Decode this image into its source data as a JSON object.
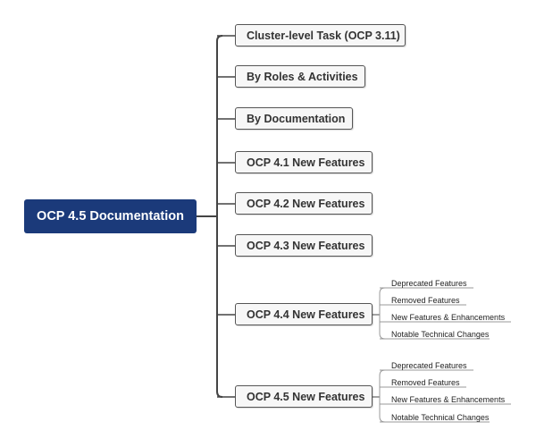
{
  "root": {
    "label": "OCP 4.5 Documentation",
    "color": "#1b3a7a"
  },
  "branches": [
    {
      "label": "Cluster-level Task (OCP 3.11)",
      "children": []
    },
    {
      "label": "By Roles & Activities",
      "children": []
    },
    {
      "label": "By Documentation",
      "children": []
    },
    {
      "label": "OCP 4.1 New Features",
      "children": []
    },
    {
      "label": "OCP 4.2 New Features",
      "children": []
    },
    {
      "label": "OCP 4.3 New Features",
      "children": []
    },
    {
      "label": "OCP 4.4 New Features",
      "children": [
        "Deprecated Features",
        "Removed Features",
        "New Features & Enhancements",
        "Notable Technical Changes"
      ]
    },
    {
      "label": "OCP 4.5 New Features",
      "children": [
        "Deprecated Features",
        "Removed Features",
        "New Features & Enhancements",
        "Notable Technical Changes"
      ]
    }
  ]
}
